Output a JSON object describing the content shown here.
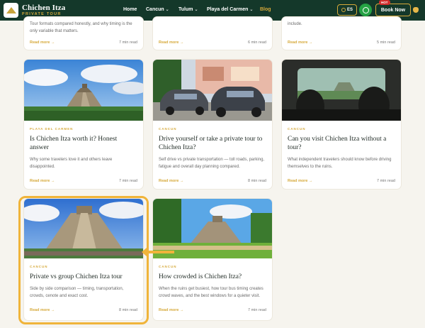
{
  "header": {
    "brand_name": "Chichen Itza",
    "brand_sub": "PRIVATE TOUR",
    "nav": [
      "Home",
      "Cancun",
      "Tulum",
      "Playa del Carmen",
      "Blog"
    ],
    "lang": "ES",
    "book_label": "Book Now",
    "hot_label": "HOT"
  },
  "top_row": [
    {
      "excerpt": "Tour formats compared honestly, and why timing is the only variable that matters.",
      "read_more": "Read more →",
      "time": "7 min read"
    },
    {
      "excerpt": "",
      "read_more": "Read more →",
      "time": "6 min read"
    },
    {
      "excerpt": "include.",
      "read_more": "Read more →",
      "time": "5 min read"
    }
  ],
  "middle_row": [
    {
      "category": "PLAYA DEL CARMEN",
      "title": "Is Chichen Itza worth it? Honest answer",
      "excerpt": "Why some travelers love it and others leave disappointed.",
      "read_more": "Read more →",
      "time": "7 min read"
    },
    {
      "category": "CANCUN",
      "title": "Drive yourself or take a private tour to Chichen Itza?",
      "excerpt": "Self drive vs private transportation — toll roads, parking, fatigue and overall day planning compared.",
      "read_more": "Read more →",
      "time": "8 min read"
    },
    {
      "category": "CANCUN",
      "title": "Can you visit Chichen Itza without a tour?",
      "excerpt": "What independent travelers should know before driving themselves to the ruins.",
      "read_more": "Read more →",
      "time": "7 min read"
    }
  ],
  "bottom_row": [
    {
      "category": "CANCUN",
      "title": "Private vs group Chichen Itza tour",
      "excerpt": "Side by side comparison — timing, transportation, crowds, cenote and exact cost.",
      "read_more": "Read more →",
      "time": "8 min read"
    },
    {
      "category": "CANCUN",
      "title": "How crowded is Chichen Itza?",
      "excerpt": "When the ruins get busiest, how tour bus timing creates crowd waves, and the best windows for a quieter visit.",
      "read_more": "Read more →",
      "time": "7 min read"
    }
  ],
  "colors": {
    "header_bg": "#14382a",
    "accent": "#d6a93a",
    "highlight": "#f0b43a",
    "whatsapp": "#25a244"
  }
}
